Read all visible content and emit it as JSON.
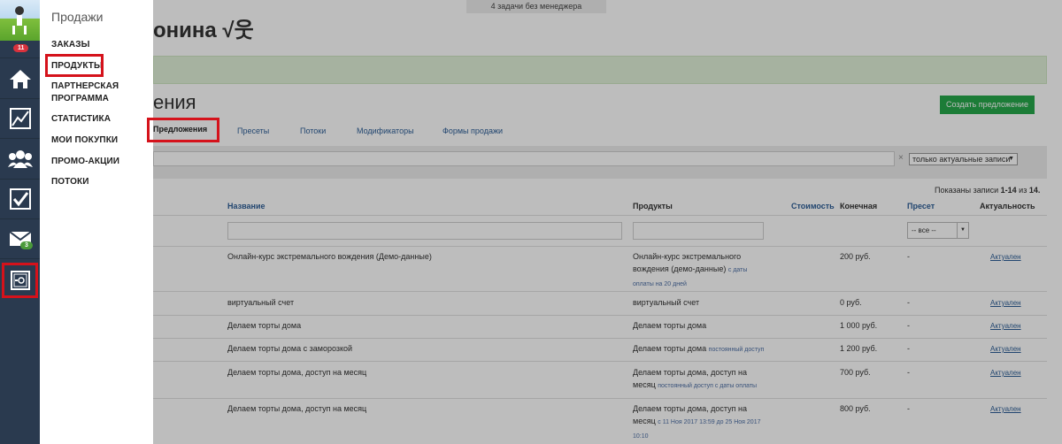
{
  "top_notice": "4 задачи без менеджера",
  "page_heading_partial": "онина √웃",
  "section_heading_partial": "ения",
  "create_button": "Создать предложение",
  "tabs": [
    "Предложения",
    "Пресеты",
    "Потоки",
    "Модификаторы",
    "Формы продажи"
  ],
  "filter_select": "только актуальные записи",
  "clear_symbol": "×",
  "records_info": {
    "prefix": "Показаны записи ",
    "range": "1-14",
    "middle": " из ",
    "total": "14."
  },
  "sidebar": {
    "title": "Продажи",
    "items": [
      "ЗАКАЗЫ",
      "ПРОДУКТЫ",
      "ПАРТНЕРСКАЯ ПРОГРАММА",
      "СТАТИСТИКА",
      "МОИ ПОКУПКИ",
      "ПРОМО-АКЦИИ",
      "ПОТОКИ"
    ]
  },
  "iconbar": {
    "badge_top": "11",
    "badge_mail": "3",
    "icons": [
      "avatar",
      "home-icon",
      "chart-icon",
      "users-icon",
      "checkbox-icon",
      "mail-icon",
      "safe-icon"
    ]
  },
  "table": {
    "headers": {
      "name": "Название",
      "products": "Продукты",
      "cost": "Стоимость",
      "final": "Конечная",
      "preset": "Пресет",
      "actuality": "Актуальность"
    },
    "preset_filter": "-- все --",
    "rows": [
      {
        "name": "Онлайн-курс экстремального вождения (Демо-данные)",
        "product_line1": "Онлайн-курс экстремального",
        "product_line2": "вождения (демо-данные)",
        "note1": "с даты",
        "note2": "оплаты на 20 дней",
        "note3": "",
        "price": "200 руб.",
        "preset": "-",
        "status": "Актуален"
      },
      {
        "name": "виртуальный счет",
        "product_line1": "виртуальный счет",
        "product_line2": "",
        "note1": "",
        "note2": "",
        "note3": "",
        "price": "0 руб.",
        "preset": "-",
        "status": "Актуален"
      },
      {
        "name": "Делаем торты дома",
        "product_line1": "Делаем торты дома",
        "product_line2": "",
        "note1": "",
        "note2": "",
        "note3": "",
        "price": "1 000 руб.",
        "preset": "-",
        "status": "Актуален"
      },
      {
        "name": "Делаем торты дома с заморозкой",
        "product_line1": "Делаем торты дома",
        "product_line2": "",
        "note1": "постоянный доступ",
        "note2": "",
        "note3": "",
        "price": "1 200 руб.",
        "preset": "-",
        "status": "Актуален"
      },
      {
        "name": "Делаем торты дома, доступ на месяц",
        "product_line1": "Делаем торты дома, доступ на",
        "product_line2": "месяц",
        "note1": "",
        "note2": "постоянный доступ с даты оплаты",
        "note3": "",
        "price": "700 руб.",
        "preset": "-",
        "status": "Актуален"
      },
      {
        "name": "Делаем торты дома, доступ на месяц",
        "product_line1": "Делаем торты дома, доступ на",
        "product_line2": "месяц",
        "note1": "",
        "note2": "с 11 Ноя 2017 13:59 до 25 Ноя 2017",
        "note3": "10:10",
        "price": "800 руб.",
        "preset": "-",
        "status": "Актуален"
      }
    ]
  },
  "colors": {
    "iconbar": "#2a3a4f",
    "accent_red": "#d5121b",
    "green_button": "#27a84b",
    "alert_green": "#e0f0d8",
    "badge_red": "#d9323d",
    "badge_green": "#4b9a3a"
  }
}
